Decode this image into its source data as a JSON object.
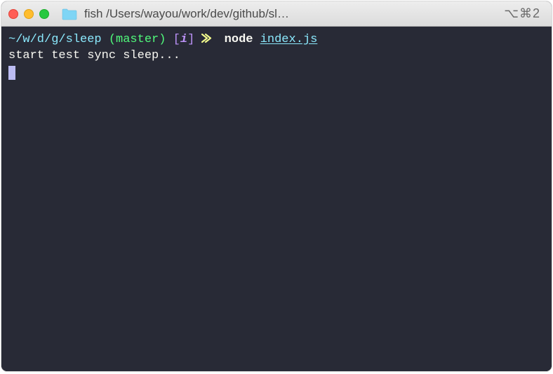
{
  "window": {
    "title": "fish /Users/wayou/work/dev/github/sl…",
    "shortcut": "⌥⌘2"
  },
  "prompt": {
    "path": "~/w/d/g/sleep",
    "branch": "master",
    "flag": "i",
    "arrow": "x>",
    "command": "node",
    "argument": "index.js"
  },
  "output": {
    "line1": "start test sync sleep..."
  },
  "colors": {
    "bg": "#282a36",
    "cyan": "#8be9fd",
    "green": "#50fa7b",
    "purple": "#bd93f9",
    "yellow": "#f1fa8c",
    "fg": "#f8f8f2",
    "cursor": "#bcbcf2"
  }
}
